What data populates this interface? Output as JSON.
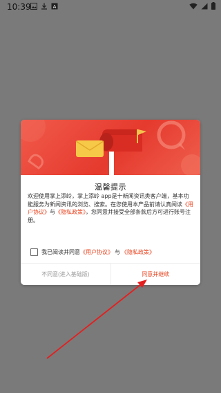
{
  "status_bar": {
    "time": "10:39"
  },
  "dialog": {
    "title": "温馨提示",
    "body_pre": "欢迎使用掌上添岭，掌上添岭 app是十新闻资讯类客户端，基本功能服务为新闻资讯的浏览、搜索。在您使用本产品前请认真阅读",
    "user_agreement_link": "《用户协议》",
    "and_text": "与",
    "privacy_link": "《隐私政策》",
    "body_post": "，您同意并接受全部条款后方可进行账号注册。",
    "agree_prefix": "我已阅读并同意",
    "agree_user_agreement": "《用户协议》",
    "agree_and": "与",
    "agree_privacy": "《隐私政策》",
    "disagree_button": "不同意(进入基础版)",
    "agree_button": "同意并继续"
  },
  "colors": {
    "accent": "#e8431f",
    "banner": "#e53a2e",
    "overlay": "#7a7a7a"
  }
}
